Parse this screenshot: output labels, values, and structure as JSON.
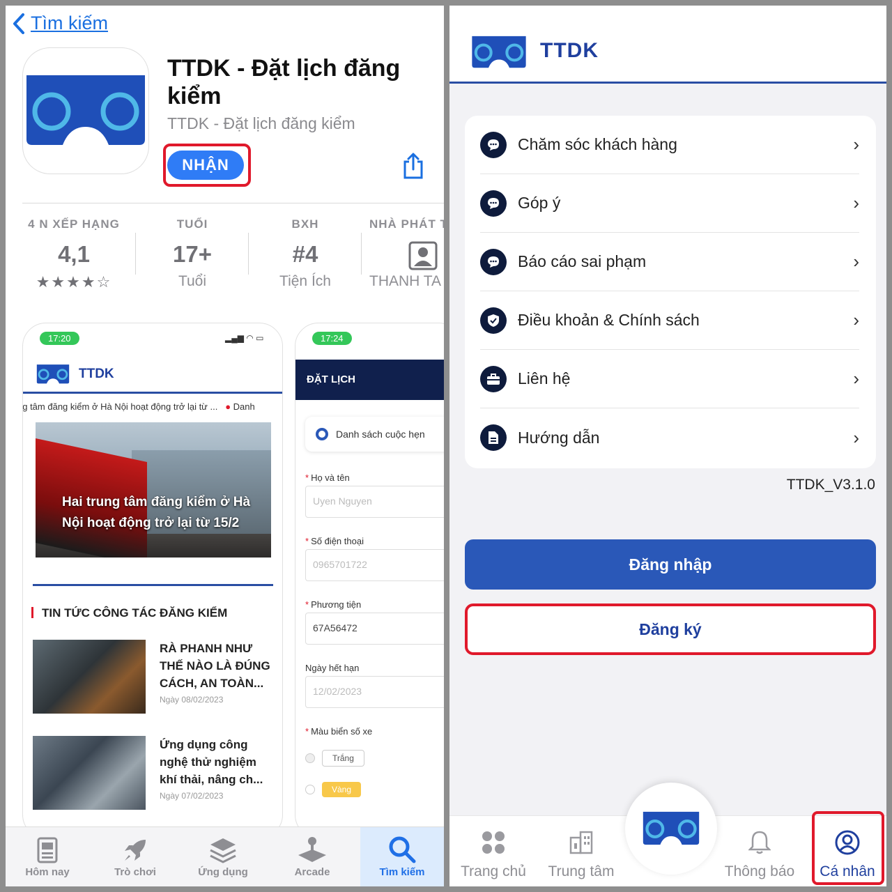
{
  "appstore": {
    "back_label": "Tìm kiếm",
    "app_title": "TTDK - Đặt lịch đăng kiểm",
    "app_subtitle": "TTDK - Đặt lịch đăng kiểm",
    "get_label": "NHẬN",
    "stats": [
      {
        "label": "4 N XẾP HẠNG",
        "value": "4,1",
        "sub": "★★★★☆"
      },
      {
        "label": "TUỔI",
        "value": "17+",
        "sub": "Tuổi"
      },
      {
        "label": "BXH",
        "value": "#4",
        "sub": "Tiện Ích"
      },
      {
        "label": "NHÀ PHÁT T",
        "value": "",
        "sub": "THANH TA"
      }
    ],
    "screenshot1": {
      "time": "17:20",
      "brand": "TTDK",
      "ticker": "ng tâm đăng kiểm ở Hà Nội hoạt động trở lại từ ...",
      "ticker_next": "Danh",
      "headline": "Hai trung tâm đăng kiểm ở Hà Nội hoạt động trở lại từ 15/2",
      "section_title": "TIN TỨC CÔNG TÁC ĐĂNG KIỂM",
      "news": [
        {
          "title": "RÀ PHANH NHƯ THẾ NÀO LÀ ĐÚNG CÁCH, AN TOÀN...",
          "date": "Ngày 08/02/2023"
        },
        {
          "title": "Ứng dụng công nghệ thử nghiệm khí thải, nâng ch...",
          "date": "Ngày 07/02/2023"
        }
      ]
    },
    "screenshot2": {
      "time": "17:24",
      "header": "ĐẶT LỊCH",
      "list_btn": "Danh sách cuộc hẹn",
      "fields": [
        {
          "label": "Họ và tên",
          "required": true,
          "value": "Uyen Nguyen"
        },
        {
          "label": "Số điện thoại",
          "required": true,
          "value": "0965701722"
        },
        {
          "label": "Phương tiện",
          "required": true,
          "value": "67A56472"
        },
        {
          "label": "Ngày hết hạn",
          "required": false,
          "value": "12/02/2023"
        }
      ],
      "plate_label": "Màu biển số xe",
      "plate_options": [
        "Trắng",
        "Vàng"
      ]
    },
    "tabs": [
      {
        "label": "Hôm nay",
        "icon": "today-icon"
      },
      {
        "label": "Trò chơi",
        "icon": "rocket-icon"
      },
      {
        "label": "Ứng dụng",
        "icon": "apps-stack-icon"
      },
      {
        "label": "Arcade",
        "icon": "joystick-icon"
      },
      {
        "label": "Tìm kiếm",
        "icon": "search-icon",
        "active": true
      }
    ]
  },
  "ttdk": {
    "brand": "TTDK",
    "menu": [
      {
        "label": "Chăm sóc khách hàng",
        "icon": "chat-icon"
      },
      {
        "label": "Góp ý",
        "icon": "chat-icon"
      },
      {
        "label": "Báo cáo sai phạm",
        "icon": "chat-icon"
      },
      {
        "label": "Điều khoản & Chính sách",
        "icon": "shield-icon"
      },
      {
        "label": "Liên hệ",
        "icon": "briefcase-icon"
      },
      {
        "label": "Hướng dẫn",
        "icon": "document-icon"
      }
    ],
    "version": "TTDK_V3.1.0",
    "login_label": "Đăng nhập",
    "register_label": "Đăng ký",
    "tabs": [
      {
        "label": "Trang chủ",
        "icon": "grid-icon"
      },
      {
        "label": "Trung tâm",
        "icon": "building-icon"
      },
      {
        "label": "Thông báo",
        "icon": "bell-icon"
      },
      {
        "label": "Cá nhân",
        "icon": "user-icon",
        "active": true
      }
    ]
  },
  "colors": {
    "ios_blue": "#2f7cf6",
    "ttdk_navy": "#1f3f9e",
    "highlight_red": "#e0192b",
    "login_blue": "#2a58b8"
  }
}
